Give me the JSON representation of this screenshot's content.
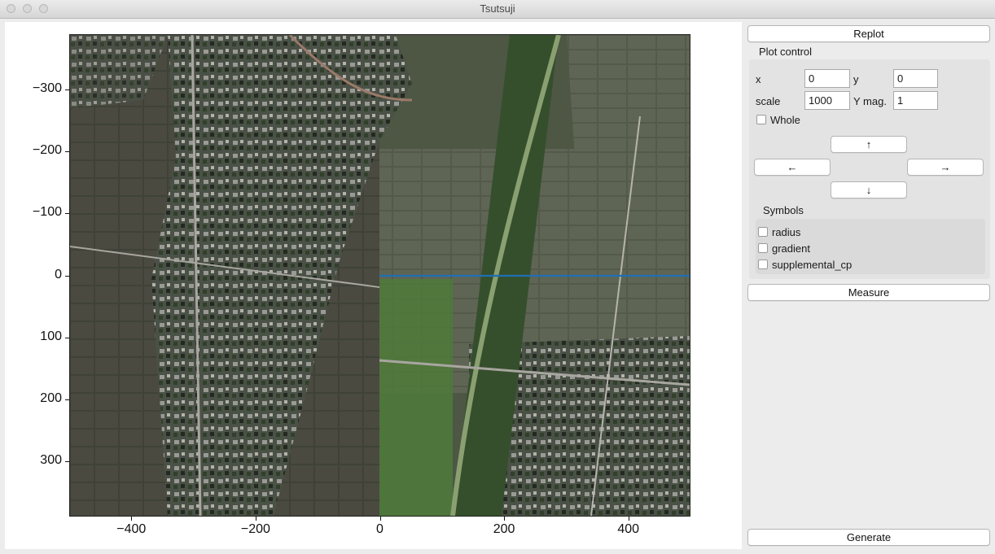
{
  "window": {
    "title": "Tsutsuji"
  },
  "plot": {
    "x_ticks": [
      "−400",
      "−200",
      "0",
      "200",
      "400"
    ],
    "y_ticks": [
      "−300",
      "−200",
      "−100",
      "0",
      "100",
      "200",
      "300"
    ],
    "x_range": [
      -500,
      500
    ],
    "y_range": [
      -390,
      390
    ],
    "y_inverted": true,
    "route_line": {
      "color": "#1f6fb4",
      "from": [
        0,
        0
      ],
      "to": [
        500,
        0
      ]
    }
  },
  "sidebar": {
    "replot_label": "Replot",
    "plot_control_label": "Plot control",
    "x_label": "x",
    "x_value": "0",
    "y_label": "y",
    "y_value": "0",
    "scale_label": "scale",
    "scale_value": "1000",
    "ymag_label": "Y mag.",
    "ymag_value": "1",
    "whole_label": "Whole",
    "up_label": "↑",
    "left_label": "←",
    "right_label": "→",
    "down_label": "↓",
    "symbols_label": "Symbols",
    "symbols": [
      "radius",
      "gradient",
      "supplemental_cp"
    ],
    "measure_label": "Measure",
    "generate_label": "Generate"
  }
}
